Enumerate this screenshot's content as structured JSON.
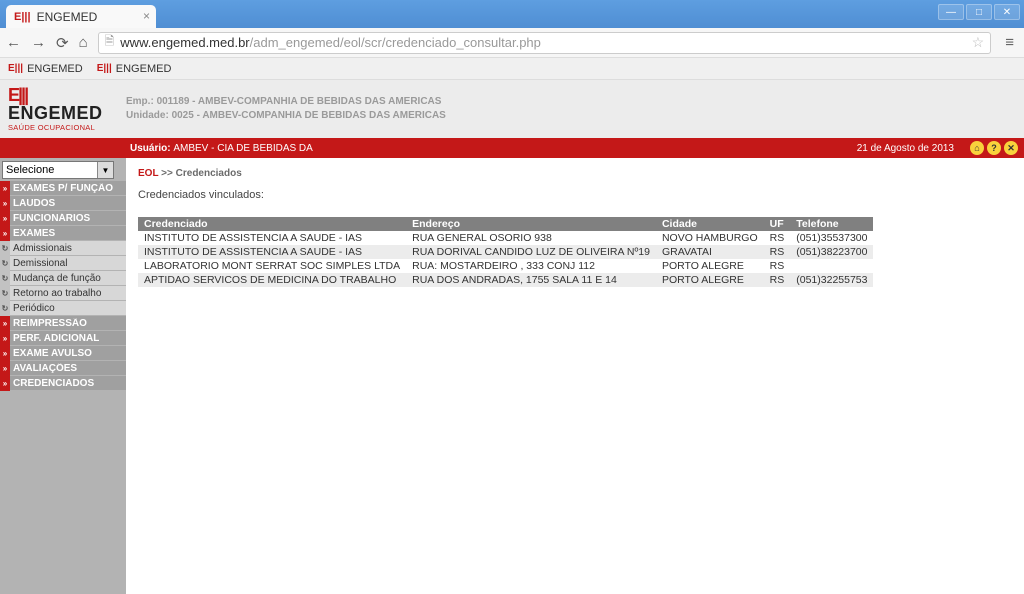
{
  "browser": {
    "tab_title": "ENGEMED",
    "url_host": "www.engemed.med.br",
    "url_path": "/adm_engemed/eol/scr/credenciado_consultar.php",
    "bookmarks": [
      "ENGEMED",
      "ENGEMED"
    ]
  },
  "logo": {
    "name": "ENGEMED",
    "subtitle": "SAÚDE OCUPACIONAL"
  },
  "header": {
    "emp_label": "Emp.:",
    "emp_value": "001189 - AMBEV-COMPANHIA DE BEBIDAS DAS AMERICAS",
    "unidade_label": "Unidade:",
    "unidade_value": "0025 - AMBEV-COMPANHIA DE BEBIDAS DAS AMERICAS"
  },
  "userbar": {
    "label": "Usuário:",
    "user": "AMBEV - CIA DE BEBIDAS DA",
    "date": "21 de Agosto de 2013"
  },
  "sidebar": {
    "select_placeholder": "Selecione",
    "items": [
      {
        "label": "EXAMES P/ FUNÇÃO",
        "sub": false
      },
      {
        "label": "LAUDOS",
        "sub": false
      },
      {
        "label": "FUNCIONÁRIOS",
        "sub": false
      },
      {
        "label": "EXAMES",
        "sub": false
      },
      {
        "label": "Admissionais",
        "sub": true
      },
      {
        "label": "Demissional",
        "sub": true
      },
      {
        "label": "Mudança de função",
        "sub": true
      },
      {
        "label": "Retorno ao trabalho",
        "sub": true
      },
      {
        "label": "Periódico",
        "sub": true
      },
      {
        "label": "REIMPRESSÃO",
        "sub": false
      },
      {
        "label": "PERF. ADICIONAL",
        "sub": false
      },
      {
        "label": "EXAME AVULSO",
        "sub": false
      },
      {
        "label": "AVALIAÇÕES",
        "sub": false
      },
      {
        "label": "CREDENCIADOS",
        "sub": false
      }
    ]
  },
  "main": {
    "breadcrumb_root": "EOL",
    "breadcrumb_sep": ">>",
    "breadcrumb_page": "Credenciados",
    "description": "Credenciados vinculados:",
    "columns": [
      "Credenciado",
      "Endereço",
      "Cidade",
      "UF",
      "Telefone"
    ],
    "rows": [
      {
        "credenciado": "INSTITUTO DE ASSISTENCIA A SAUDE - IAS",
        "endereco": "RUA GENERAL OSORIO 938",
        "cidade": "NOVO HAMBURGO",
        "uf": "RS",
        "telefone": "(051)35537300"
      },
      {
        "credenciado": "INSTITUTO DE ASSISTENCIA A SAUDE - IAS",
        "endereco": "RUA DORIVAL CANDIDO LUZ DE OLIVEIRA Nº19",
        "cidade": "GRAVATAI",
        "uf": "RS",
        "telefone": "(051)38223700"
      },
      {
        "credenciado": "LABORATORIO MONT SERRAT SOC SIMPLES LTDA",
        "endereco": "RUA: MOSTARDEIRO , 333 CONJ 112",
        "cidade": "PORTO ALEGRE",
        "uf": "RS",
        "telefone": ""
      },
      {
        "credenciado": "APTIDAO SERVICOS DE MEDICINA DO TRABALHO",
        "endereco": "RUA DOS ANDRADAS, 1755 SALA 11 E 14",
        "cidade": "PORTO ALEGRE",
        "uf": "RS",
        "telefone": "(051)32255753"
      }
    ]
  }
}
